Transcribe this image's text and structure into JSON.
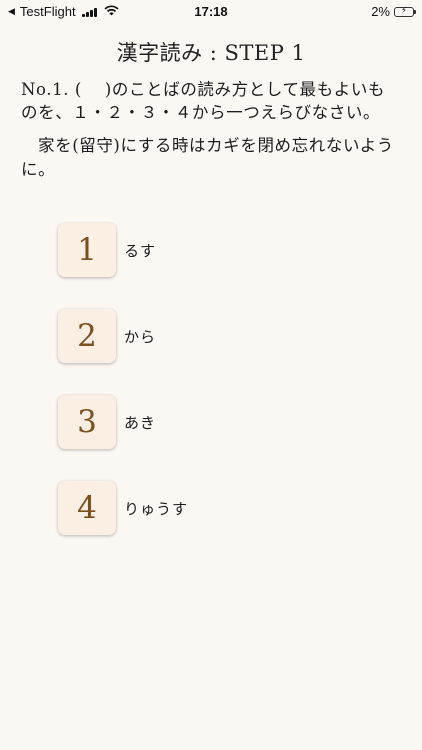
{
  "status_bar": {
    "back_app": "TestFlight",
    "time": "17:18",
    "battery_percent": "2%",
    "signal_bars": 4,
    "battery_charging": true
  },
  "screen": {
    "title": "漢字読み : STEP 1",
    "question": "No.1. (　 )のことばの読み方として最もよいものを、１・２・３・４から一つえらびなさい。",
    "sentence": "家を(留守)にする時はカギを閉め忘れないように。"
  },
  "choices": [
    {
      "number": "1",
      "label": "るす"
    },
    {
      "number": "2",
      "label": "から"
    },
    {
      "number": "3",
      "label": "あき"
    },
    {
      "number": "4",
      "label": "りゅうす"
    }
  ],
  "colors": {
    "background": "#fbf7f3",
    "choice_button": "#fbeee3",
    "choice_number": "#7a4f1e"
  }
}
